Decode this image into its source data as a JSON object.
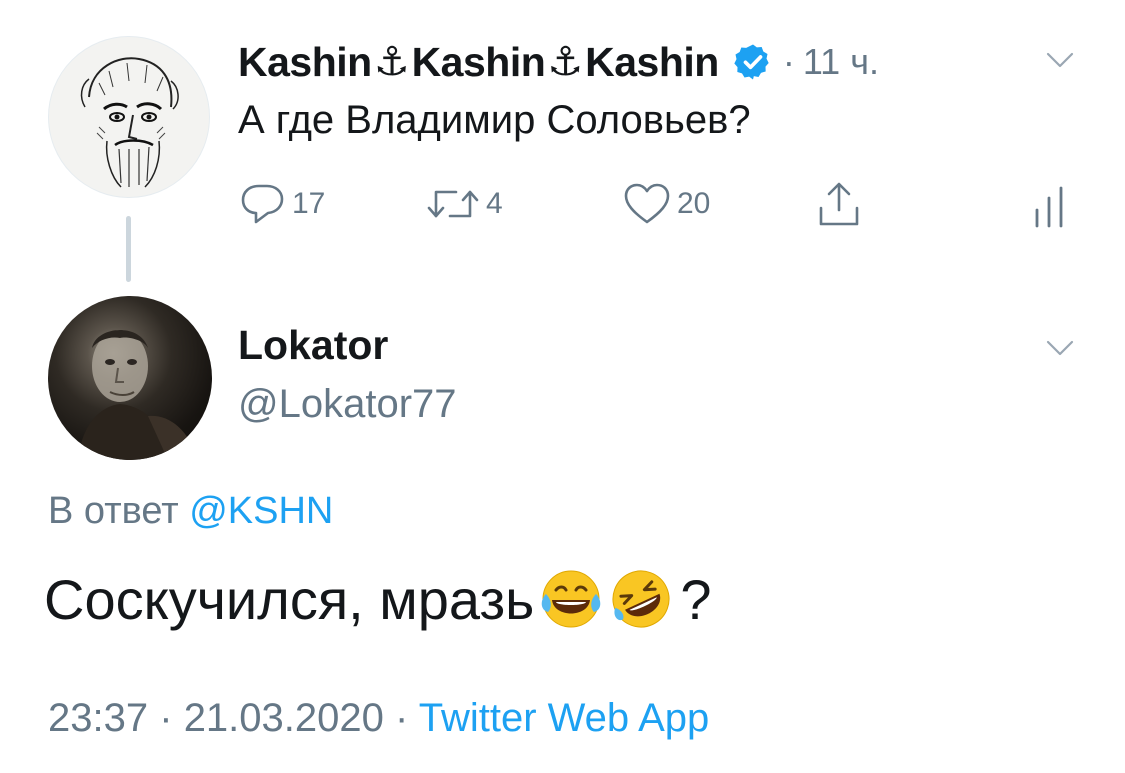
{
  "parent_tweet": {
    "name_part_1": "Kashin",
    "name_part_2": "Kashin",
    "name_part_3": "Kashin",
    "anchor_glyph": "⚓",
    "verified": true,
    "separator": "·",
    "time_ago": "11 ч.",
    "text": "А где Владимир Соловьев?",
    "actions": {
      "replies": "17",
      "retweets": "4",
      "likes": "20"
    }
  },
  "reply_tweet": {
    "name": "Lokator",
    "handle": "@Lokator77",
    "reply_to_prefix": "В ответ",
    "reply_to_handle": "@KSHN",
    "text": "Соскучился, мразь",
    "text_suffix": "?",
    "emojis": [
      "face-with-tears-of-joy",
      "rolling-on-the-floor-laughing"
    ],
    "time": "23:37",
    "separator": "·",
    "date": "21.03.2020",
    "source": "Twitter Web App"
  },
  "colors": {
    "text_primary": "#14171a",
    "text_secondary": "#657786",
    "link_blue": "#1da1f2",
    "thread_line": "#ccd6dd"
  }
}
